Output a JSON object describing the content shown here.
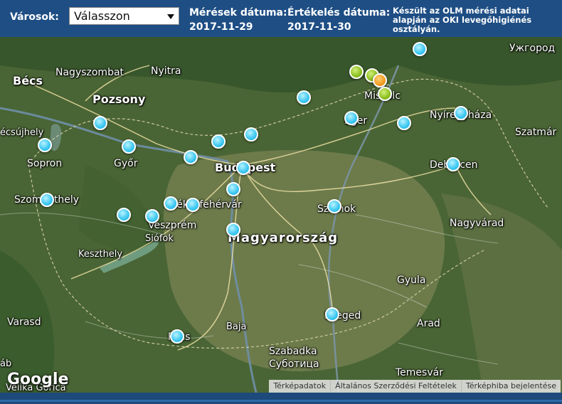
{
  "header": {
    "cities_label": "Városok:",
    "city_select_value": "Válasszon",
    "measurement_label": "Mérések dátuma:",
    "measurement_date": "2017-11-29",
    "evaluation_label": "Értékelés dátuma:",
    "evaluation_date": "2017-11-30",
    "note": "Készült az OLM mérési adatai alapján az OKI levegőhigiénés osztályán."
  },
  "map": {
    "places": {
      "becs": "Bécs",
      "nagyszombat": "Nagyszombat",
      "nyitra": "Nyitra",
      "pozsony": "Pozsony",
      "sopron": "Sopron",
      "gyor": "Győr",
      "szombathely": "Szombathely",
      "budapest": "Budapest",
      "szekesfehervar": "Székesfehérvár",
      "veszprem": "Veszprém",
      "siofok": "Siófok",
      "keszthely": "Keszthely",
      "magyarorszag": "Magyarország",
      "miskolc": "Miskolc",
      "eger": "Eger",
      "nyiregyhaza": "Nyíregyháza",
      "debrecen": "Debrecen",
      "szatmar": "Szatmár",
      "uzhgorod": "Ужгород",
      "szolnok": "Szolnok",
      "nagyvarad": "Nagyvárad",
      "gyula": "Gyula",
      "szeged": "Szeged",
      "arad": "Arad",
      "pecs": "Pécs",
      "baja": "Baja",
      "varasd": "Varasd",
      "szabadka": "Szabadka",
      "subotica": "Суботица",
      "temesvar": "Temesvár",
      "velika_gorica": "Velika Gorica",
      "sopronkeresztur_partial": "écsújhely",
      "zab_partial": "áb"
    },
    "markers_status": {
      "blue_count": 26,
      "green_count": 3,
      "orange_count": 1
    },
    "colors": {
      "blue": "#39c6f0",
      "green": "#8bbf1e",
      "orange": "#f29a1f"
    },
    "google_logo": "Google",
    "attribution": {
      "map_data": "Térképadatok",
      "terms": "Általános Szerződési Feltételek",
      "report": "Térképhiba bejelentése"
    }
  }
}
